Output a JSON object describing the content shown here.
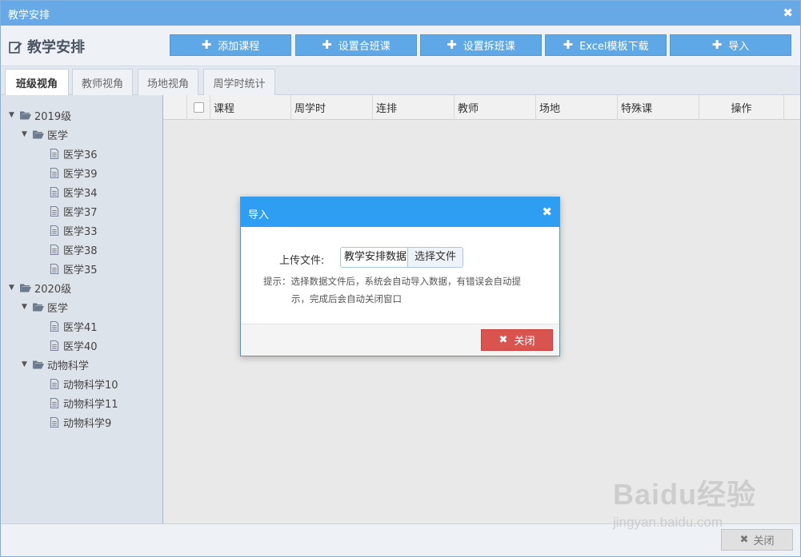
{
  "window": {
    "title": "教学安排"
  },
  "header": {
    "title": "教学安排",
    "buttons": [
      {
        "label": "添加课程"
      },
      {
        "label": "设置合班课"
      },
      {
        "label": "设置拆班课"
      },
      {
        "label": "Excel模板下载"
      },
      {
        "label": "导入"
      }
    ]
  },
  "tabs": [
    {
      "label": "班级视角",
      "active": true
    },
    {
      "label": "教师视角"
    },
    {
      "label": "场地视角"
    },
    {
      "label": "周学时统计"
    }
  ],
  "tree": [
    {
      "label": "2019级",
      "type": "folder",
      "level": 0
    },
    {
      "label": "医学",
      "type": "folder",
      "level": 1
    },
    {
      "label": "医学36",
      "type": "file",
      "level": 2
    },
    {
      "label": "医学39",
      "type": "file",
      "level": 2
    },
    {
      "label": "医学34",
      "type": "file",
      "level": 2
    },
    {
      "label": "医学37",
      "type": "file",
      "level": 2
    },
    {
      "label": "医学33",
      "type": "file",
      "level": 2
    },
    {
      "label": "医学38",
      "type": "file",
      "level": 2
    },
    {
      "label": "医学35",
      "type": "file",
      "level": 2
    },
    {
      "label": "2020级",
      "type": "folder",
      "level": 0
    },
    {
      "label": "医学",
      "type": "folder",
      "level": 1
    },
    {
      "label": "医学41",
      "type": "file",
      "level": 2
    },
    {
      "label": "医学40",
      "type": "file",
      "level": 2
    },
    {
      "label": "动物科学",
      "type": "folder",
      "level": 1
    },
    {
      "label": "动物科学10",
      "type": "file",
      "level": 2
    },
    {
      "label": "动物科学11",
      "type": "file",
      "level": 2
    },
    {
      "label": "动物科学9",
      "type": "file",
      "level": 2
    }
  ],
  "grid": {
    "columns": [
      "课程",
      "周学时",
      "连排",
      "教师",
      "场地",
      "特殊课",
      "操作"
    ]
  },
  "dialog": {
    "title": "导入",
    "upload_label": "上传文件:",
    "file_value": "教学安排数据",
    "file_button": "选择文件",
    "hint_line1": "提示：选择数据文件后，系统会自动导入数据，有错误会自动提",
    "hint_line2": "示，完成后会自动关闭窗口",
    "close_label": "关闭"
  },
  "footer": {
    "close_label": "关闭"
  },
  "watermark": {
    "logo": "Baidu经验",
    "url": "jingyan.baidu.com"
  },
  "colors": {
    "titlebar": "#67a9e6",
    "primary_button": "#5fa8e8",
    "dialog_header": "#2d9ef2",
    "danger_button": "#d9534f"
  }
}
